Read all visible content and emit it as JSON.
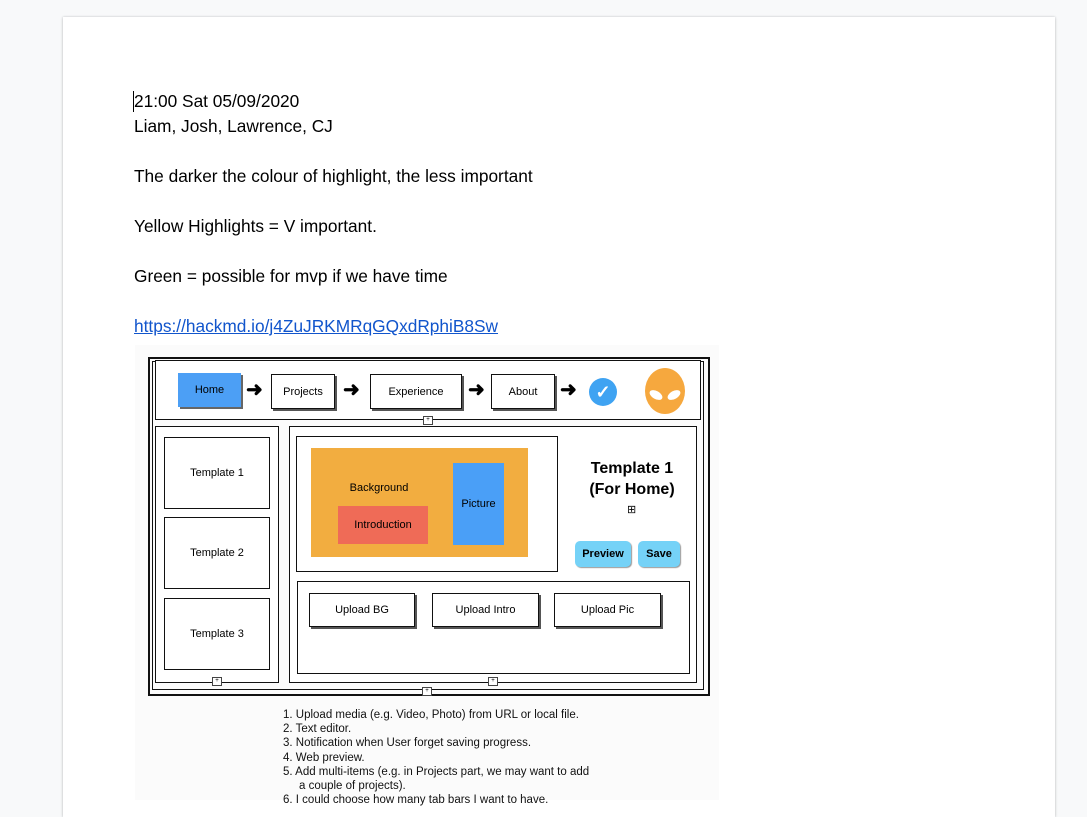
{
  "document": {
    "lines": [
      "21:00 Sat 05/09/2020",
      "Liam, Josh, Lawrence, CJ",
      "The darker the colour of highlight, the less important",
      "Yellow Highlights = V important.",
      "Green = possible for mvp if we have time"
    ],
    "link": "https://hackmd.io/j4ZuJRKMRqGQxdRphiB8Sw"
  },
  "wireframe": {
    "nav": {
      "home": "Home",
      "projects": "Projects",
      "experience": "Experience",
      "about": "About"
    },
    "templates": [
      "Template 1",
      "Template 2",
      "Template 3"
    ],
    "preview": {
      "background": "Background",
      "introduction": "Introduction",
      "picture": "Picture"
    },
    "title_line1": "Template 1",
    "title_line2": "(For Home)",
    "preview_button": "Preview",
    "save_button": "Save",
    "uploads": [
      "Upload BG",
      "Upload Intro",
      "Upload Pic"
    ],
    "features": [
      "1.  Upload media (e.g. Video, Photo) from URL or local file.",
      "2.  Text editor.",
      "3.  Notification when User forget saving progress.",
      "4.  Web preview.",
      "5.  Add multi-items (e.g. in Projects part, we may want to add",
      "     a couple of projects).",
      "6.  I could choose how many tab bars I want to have."
    ]
  },
  "colors": {
    "link": "#1155cc",
    "home_button": "#4c9ff5",
    "background_block": "#f2ad40",
    "introduction_block": "#ef6b57",
    "picture_block": "#4a9ff7",
    "action_buttons": "#75d2f7",
    "alien_logo": "#f6a83e"
  }
}
